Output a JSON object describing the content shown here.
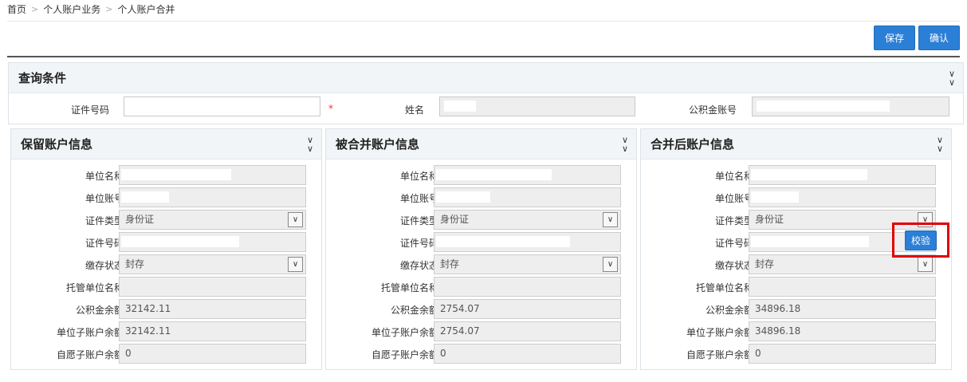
{
  "breadcrumb": [
    "首页",
    "个人账户业务",
    "个人账户合并"
  ],
  "toolbar": {
    "save_label": "保存",
    "confirm_label": "确认"
  },
  "query": {
    "title": "查询条件",
    "id_label": "证件号码",
    "id_value": "",
    "required_mark": "*",
    "name_label": "姓名",
    "account_label": "公积金账号"
  },
  "panels": [
    {
      "title": "保留账户信息",
      "fields": {
        "unit_name_label": "单位名称",
        "unit_account_label": "单位账号",
        "id_type_label": "证件类型",
        "id_type_value": "身份证",
        "id_no_label": "证件号码",
        "status_label": "缴存状态",
        "status_value": "封存",
        "trust_unit_label": "托管单位名称",
        "trust_unit_value": "",
        "fund_balance_label": "公积金余额",
        "fund_balance_value": "32142.11",
        "unit_sub_label": "单位子账户余额",
        "unit_sub_value": "32142.11",
        "vol_sub_label": "自愿子账户余额",
        "vol_sub_value": "0"
      }
    },
    {
      "title": "被合并账户信息",
      "fields": {
        "unit_name_label": "单位名称",
        "unit_account_label": "单位账号",
        "id_type_label": "证件类型",
        "id_type_value": "身份证",
        "id_no_label": "证件号码",
        "status_label": "缴存状态",
        "status_value": "封存",
        "trust_unit_label": "托管单位名称",
        "trust_unit_value": "",
        "fund_balance_label": "公积金余额",
        "fund_balance_value": "2754.07",
        "unit_sub_label": "单位子账户余额",
        "unit_sub_value": "2754.07",
        "vol_sub_label": "自愿子账户余额",
        "vol_sub_value": "0"
      }
    },
    {
      "title": "合并后账户信息",
      "verify_label": "校验",
      "fields": {
        "unit_name_label": "单位名称",
        "unit_account_label": "单位账号",
        "id_type_label": "证件类型",
        "id_type_value": "身份证",
        "id_no_label": "证件号码",
        "status_label": "缴存状态",
        "status_value": "封存",
        "trust_unit_label": "托管单位名称",
        "trust_unit_value": "",
        "fund_balance_label": "公积金余额",
        "fund_balance_value": "34896.18",
        "unit_sub_label": "单位子账户余额",
        "unit_sub_value": "34896.18",
        "vol_sub_label": "自愿子账户余额",
        "vol_sub_value": "0"
      }
    }
  ],
  "icons": {
    "collapse": "double-chevron-down-icon",
    "dropdown": "chevron-down-icon"
  },
  "colors": {
    "primary_button": "#2b7fd6",
    "highlight_box": "#e00000",
    "required": "#e33333"
  }
}
